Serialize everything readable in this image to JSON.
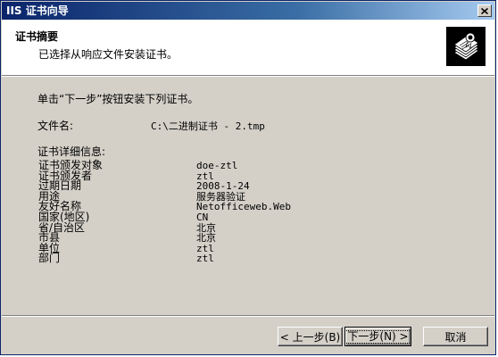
{
  "window": {
    "title": "IIS 证书向导"
  },
  "header": {
    "title": "证书摘要",
    "subtitle": "已选择从响应文件安装证书。"
  },
  "body": {
    "instruction": "单击“下一步”按钮安装下列证书。",
    "filename_label": "文件名:",
    "filename_value": "C:\\二进制证书 - 2.tmp",
    "details_heading": "证书详细信息:",
    "details": [
      {
        "label": "证书颁发对象",
        "value": "doe-ztl"
      },
      {
        "label": "证书颁发者",
        "value": "ztl"
      },
      {
        "label": "过期日期",
        "value": "2008-1-24"
      },
      {
        "label": "用途",
        "value": "服务器验证"
      },
      {
        "label": "友好名称",
        "value": "Netofficeweb.Web"
      },
      {
        "label": "国家(地区)",
        "value": "CN"
      },
      {
        "label": "省/自治区",
        "value": "北京"
      },
      {
        "label": "市县",
        "value": "北京"
      },
      {
        "label": "单位",
        "value": "ztl"
      },
      {
        "label": "部门",
        "value": "ztl"
      }
    ]
  },
  "buttons": {
    "back": "< 上一步(B)",
    "next": "下一步(N) >",
    "cancel": "取消"
  },
  "icons": {
    "close": "close-icon",
    "header": "certificate-icon"
  }
}
